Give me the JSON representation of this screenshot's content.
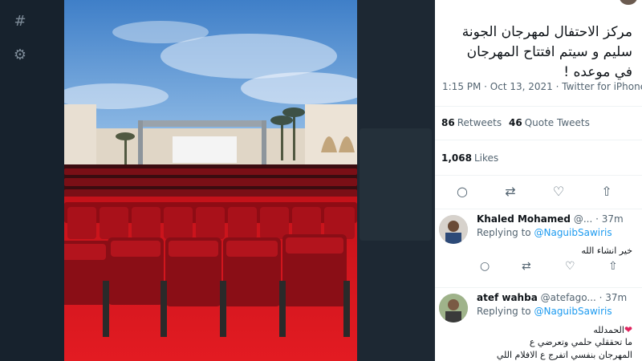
{
  "nav": {
    "icons": [
      "hashtag-icon",
      "settings-icon"
    ],
    "hashtag_glyph": "#",
    "settings_glyph": "⚙"
  },
  "photo": {
    "description_colors": {
      "sky": "#4f8fd2",
      "seats": "#b1101a",
      "carpet": "#d8141c",
      "screen": "#f2f2f2"
    }
  },
  "tweet": {
    "text_line_1": "مركز الاحتفال لمهرجان الجونة",
    "text_line_2": "سليم و سيتم افتتاح المهرجان",
    "text_line_3": "في موعده !",
    "meta": "1:15 PM · Oct 13, 2021 · Twitter for iPhone",
    "retweets_count": "86",
    "retweets_label": "Retweets",
    "quote_count": "46",
    "quote_label": "Quote Tweets",
    "likes_count": "1,068",
    "likes_label": "Likes"
  },
  "actions": {
    "reply_glyph": "○",
    "retweet_glyph": "⇄",
    "like_glyph": "♡",
    "share_glyph": "⇧"
  },
  "replies": [
    {
      "name": "Khaled Mohamed",
      "handle": "@... · 37m",
      "replying_label": "Replying to",
      "mention": "@NaguibSawiris",
      "body_line_1": "خير انشاء الله",
      "body_line_2": ""
    },
    {
      "name": "atef wahba",
      "handle": "@atefago... · 37m",
      "replying_label": "Replying to",
      "mention": "@NaguibSawiris",
      "body_line_1": "الحمدلله",
      "body_line_2": "ما تحققلي حلمي وتعرضي ع",
      "body_line_3": "المهرجان بنفسي اتفرج ع الافلام اللي"
    }
  ],
  "reply_actions": {
    "reply_glyph": "○",
    "retweet_glyph": "⇄",
    "like_glyph": "♡",
    "share_glyph": "⇧"
  }
}
